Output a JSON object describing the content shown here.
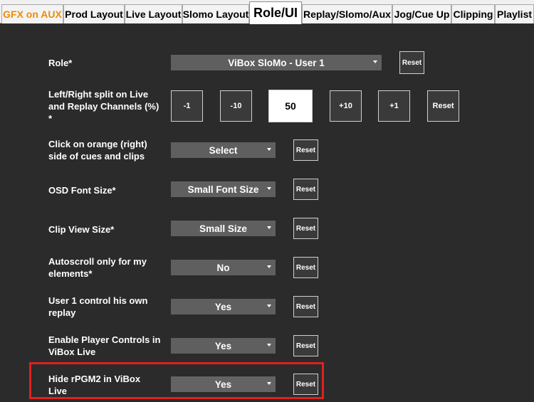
{
  "tabs": [
    {
      "label": "GFX on AUX"
    },
    {
      "label": "Prod Layout"
    },
    {
      "label": "Live Layout"
    },
    {
      "label": "Slomo Layout"
    },
    {
      "label": "Role/UI"
    },
    {
      "label": "Replay/Slomo/Aux"
    },
    {
      "label": "Jog/Cue Up"
    },
    {
      "label": "Clipping"
    },
    {
      "label": "Playlist"
    }
  ],
  "settings": {
    "role": {
      "line1": "Role*",
      "value": "ViBox SloMo - User 1",
      "reset": "Reset"
    },
    "split": {
      "line1": "Left/Right split on Live",
      "line2": "and Replay Channels (%)",
      "line3": "*",
      "buttons": [
        "-1",
        "-10",
        "+10",
        "+1"
      ],
      "value": "50",
      "reset": "Reset"
    },
    "click": {
      "line1": "Click on orange (right)",
      "line2": "side of cues and clips",
      "value": "Select",
      "reset": "Reset"
    },
    "osd": {
      "line1": "OSD Font Size*",
      "value": "Small Font Size",
      "reset": "Reset"
    },
    "clipview": {
      "line1": "Clip View Size*",
      "value": "Small Size",
      "reset": "Reset"
    },
    "autoscroll": {
      "line1": "Autoscroll only for my",
      "line2": "elements*",
      "value": "No",
      "reset": "Reset"
    },
    "user1": {
      "line1": "User 1 control his own",
      "line2": "replay",
      "value": "Yes",
      "reset": "Reset"
    },
    "player": {
      "line1": "Enable Player Controls in",
      "line2": "ViBox Live",
      "value": "Yes",
      "reset": "Reset"
    },
    "hide": {
      "line1": "Hide rPGM2 in ViBox",
      "line2": "Live",
      "value": "Yes",
      "reset": "Reset"
    }
  },
  "colors": {
    "accent_tab": "#f08c00",
    "highlight": "#e02020",
    "background": "#2b2b2b",
    "dropdown": "#5f5f5f"
  }
}
